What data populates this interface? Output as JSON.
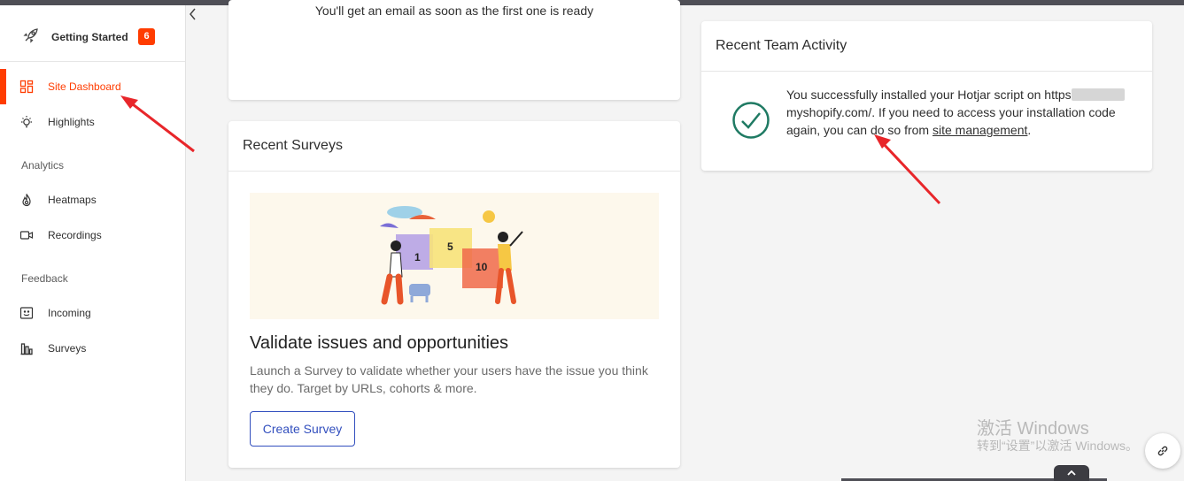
{
  "sidebar": {
    "getting_started": {
      "label": "Getting Started",
      "badge": "6"
    },
    "items": [
      {
        "label": "Site Dashboard"
      },
      {
        "label": "Highlights"
      }
    ],
    "analytics": {
      "section_label": "Analytics",
      "items": [
        {
          "label": "Heatmaps"
        },
        {
          "label": "Recordings"
        }
      ]
    },
    "feedback": {
      "section_label": "Feedback",
      "items": [
        {
          "label": "Incoming"
        },
        {
          "label": "Surveys"
        }
      ]
    }
  },
  "email_card": {
    "text": "You'll get an email as soon as the first one is ready"
  },
  "surveys_card": {
    "title": "Recent Surveys",
    "illustration": {
      "numbers": [
        "1",
        "5",
        "10"
      ]
    },
    "heading": "Validate issues and opportunities",
    "description": "Launch a Survey to validate whether your users have the issue you think they do. Target by URLs, cohorts & more.",
    "button": "Create Survey"
  },
  "activity_card": {
    "title": "Recent Team Activity",
    "text_start": "You successfully installed your Hotjar script on https",
    "text_mid": "myshopify.com/. If you need to access your installation code again, you can do so from ",
    "link": "site management",
    "text_end": "."
  },
  "watermark": {
    "line1": "激活 Windows",
    "line2": "转到“设置”以激活 Windows。"
  },
  "colors": {
    "accent": "#ff3c00",
    "primary_button": "#324fbe",
    "success": "#1f7a63",
    "annotation_arrow": "#e8262a"
  }
}
